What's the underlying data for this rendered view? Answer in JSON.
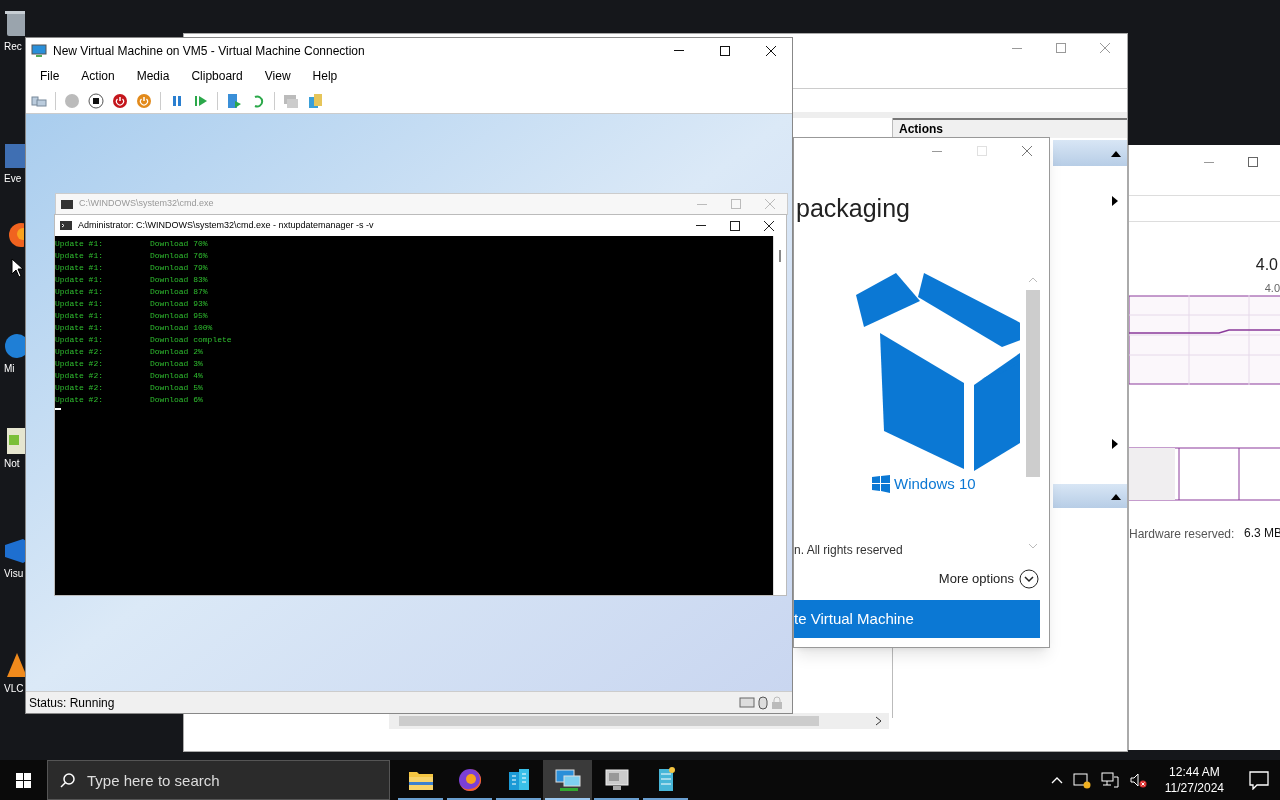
{
  "desktop_icons": [
    {
      "label": "Rec",
      "kind": "bin"
    },
    {
      "label": "Eve",
      "kind": "shortcut"
    },
    {
      "label": "Mi",
      "kind": "edge"
    },
    {
      "label": "Not",
      "kind": "notepad"
    },
    {
      "label": "Visu",
      "kind": "vs"
    },
    {
      "label": "VLC",
      "kind": "vlc"
    }
  ],
  "manager": {
    "actions_title": "Actions",
    "graph_value": "4.0",
    "graph_small": "4.0",
    "hardware_label": "Hardware reserved:",
    "hardware_value": "6.3 MB"
  },
  "wizard": {
    "heading": "packaging",
    "logo_text": "Windows 10",
    "footer": "n. All rights reserved",
    "more": "More options",
    "button": "te Virtual Machine"
  },
  "vm_window": {
    "title": "New Virtual Machine on VM5 - Virtual Machine Connection",
    "menu": [
      "File",
      "Action",
      "Media",
      "Clipboard",
      "View",
      "Help"
    ],
    "status": "Status: Running"
  },
  "cmd_back": {
    "title": "C:\\WINDOWS\\system32\\cmd.exe"
  },
  "cmd": {
    "title": "Administrator: C:\\WINDOWS\\system32\\cmd.exe - nxtupdatemanager  -s -v",
    "lines": [
      {
        "label": "Update #1:",
        "text": "Download 70%"
      },
      {
        "label": "Update #1:",
        "text": "Download 76%"
      },
      {
        "label": "Update #1:",
        "text": "Download 79%"
      },
      {
        "label": "Update #1:",
        "text": "Download 83%"
      },
      {
        "label": "Update #1:",
        "text": "Download 87%"
      },
      {
        "label": "Update #1:",
        "text": "Download 93%"
      },
      {
        "label": "Update #1:",
        "text": "Download 95%"
      },
      {
        "label": "Update #1:",
        "text": "Download 100%"
      },
      {
        "label": "Update #1:",
        "text": "Download complete"
      },
      {
        "label": "Update #2:",
        "text": "Download 2%"
      },
      {
        "label": "Update #2:",
        "text": "Download 3%"
      },
      {
        "label": "Update #2:",
        "text": "Download 4%"
      },
      {
        "label": "Update #2:",
        "text": "Download 5%"
      },
      {
        "label": "Update #2:",
        "text": "Download 6%"
      }
    ]
  },
  "taskbar": {
    "search_placeholder": "Type here to search",
    "apps": [
      {
        "kind": "folder",
        "selected": false
      },
      {
        "kind": "firefox",
        "selected": false
      },
      {
        "kind": "building",
        "selected": false
      },
      {
        "kind": "vmconnect",
        "selected": true
      },
      {
        "kind": "monitor",
        "selected": false
      },
      {
        "kind": "server",
        "selected": false
      }
    ],
    "time": "12:44 AM",
    "date": "11/27/2024"
  }
}
